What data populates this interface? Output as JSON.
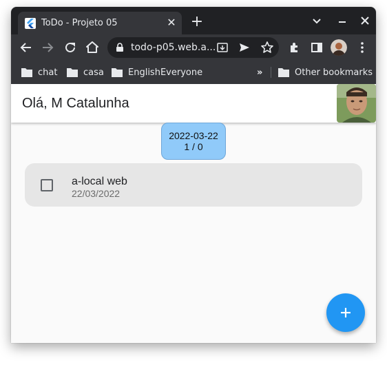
{
  "browser": {
    "tab_title": "ToDo - Projeto 05",
    "url": "todo-p05.web.a...",
    "bookmarks": [
      {
        "label": "chat"
      },
      {
        "label": "casa"
      },
      {
        "label": "EnglishEveryone"
      }
    ],
    "other_bookmarks": "Other bookmarks",
    "overflow": "»"
  },
  "app": {
    "greeting": "Olá, M Catalunha",
    "date_group": {
      "date": "2022-03-22",
      "counts": "1 / 0"
    },
    "tasks": [
      {
        "title": "a-local web",
        "date": "22/03/2022",
        "done": false
      }
    ]
  },
  "colors": {
    "chip": "#90caf9",
    "fab": "#2196f3",
    "card": "#e6e6e6"
  }
}
